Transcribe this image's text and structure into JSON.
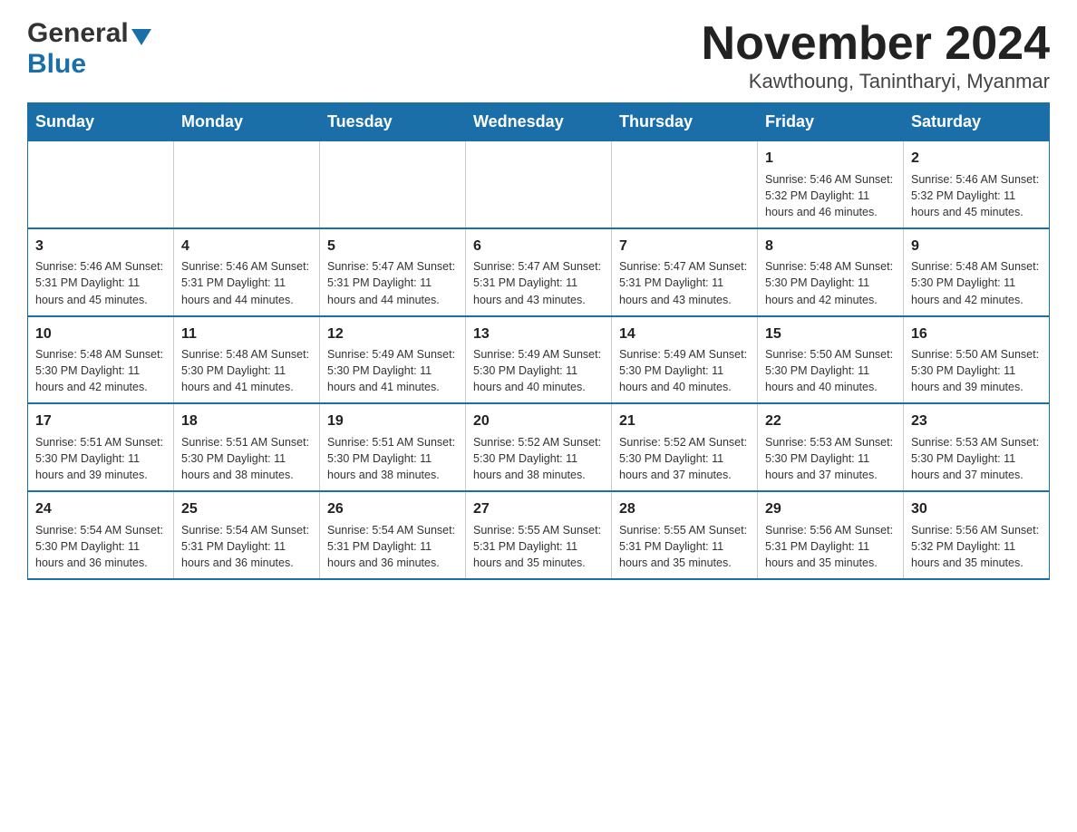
{
  "logo": {
    "general": "General",
    "blue": "Blue"
  },
  "title": "November 2024",
  "subtitle": "Kawthoung, Tanintharyi, Myanmar",
  "days": [
    "Sunday",
    "Monday",
    "Tuesday",
    "Wednesday",
    "Thursday",
    "Friday",
    "Saturday"
  ],
  "weeks": [
    [
      {
        "day": "",
        "info": ""
      },
      {
        "day": "",
        "info": ""
      },
      {
        "day": "",
        "info": ""
      },
      {
        "day": "",
        "info": ""
      },
      {
        "day": "",
        "info": ""
      },
      {
        "day": "1",
        "info": "Sunrise: 5:46 AM\nSunset: 5:32 PM\nDaylight: 11 hours and 46 minutes."
      },
      {
        "day": "2",
        "info": "Sunrise: 5:46 AM\nSunset: 5:32 PM\nDaylight: 11 hours and 45 minutes."
      }
    ],
    [
      {
        "day": "3",
        "info": "Sunrise: 5:46 AM\nSunset: 5:31 PM\nDaylight: 11 hours and 45 minutes."
      },
      {
        "day": "4",
        "info": "Sunrise: 5:46 AM\nSunset: 5:31 PM\nDaylight: 11 hours and 44 minutes."
      },
      {
        "day": "5",
        "info": "Sunrise: 5:47 AM\nSunset: 5:31 PM\nDaylight: 11 hours and 44 minutes."
      },
      {
        "day": "6",
        "info": "Sunrise: 5:47 AM\nSunset: 5:31 PM\nDaylight: 11 hours and 43 minutes."
      },
      {
        "day": "7",
        "info": "Sunrise: 5:47 AM\nSunset: 5:31 PM\nDaylight: 11 hours and 43 minutes."
      },
      {
        "day": "8",
        "info": "Sunrise: 5:48 AM\nSunset: 5:30 PM\nDaylight: 11 hours and 42 minutes."
      },
      {
        "day": "9",
        "info": "Sunrise: 5:48 AM\nSunset: 5:30 PM\nDaylight: 11 hours and 42 minutes."
      }
    ],
    [
      {
        "day": "10",
        "info": "Sunrise: 5:48 AM\nSunset: 5:30 PM\nDaylight: 11 hours and 42 minutes."
      },
      {
        "day": "11",
        "info": "Sunrise: 5:48 AM\nSunset: 5:30 PM\nDaylight: 11 hours and 41 minutes."
      },
      {
        "day": "12",
        "info": "Sunrise: 5:49 AM\nSunset: 5:30 PM\nDaylight: 11 hours and 41 minutes."
      },
      {
        "day": "13",
        "info": "Sunrise: 5:49 AM\nSunset: 5:30 PM\nDaylight: 11 hours and 40 minutes."
      },
      {
        "day": "14",
        "info": "Sunrise: 5:49 AM\nSunset: 5:30 PM\nDaylight: 11 hours and 40 minutes."
      },
      {
        "day": "15",
        "info": "Sunrise: 5:50 AM\nSunset: 5:30 PM\nDaylight: 11 hours and 40 minutes."
      },
      {
        "day": "16",
        "info": "Sunrise: 5:50 AM\nSunset: 5:30 PM\nDaylight: 11 hours and 39 minutes."
      }
    ],
    [
      {
        "day": "17",
        "info": "Sunrise: 5:51 AM\nSunset: 5:30 PM\nDaylight: 11 hours and 39 minutes."
      },
      {
        "day": "18",
        "info": "Sunrise: 5:51 AM\nSunset: 5:30 PM\nDaylight: 11 hours and 38 minutes."
      },
      {
        "day": "19",
        "info": "Sunrise: 5:51 AM\nSunset: 5:30 PM\nDaylight: 11 hours and 38 minutes."
      },
      {
        "day": "20",
        "info": "Sunrise: 5:52 AM\nSunset: 5:30 PM\nDaylight: 11 hours and 38 minutes."
      },
      {
        "day": "21",
        "info": "Sunrise: 5:52 AM\nSunset: 5:30 PM\nDaylight: 11 hours and 37 minutes."
      },
      {
        "day": "22",
        "info": "Sunrise: 5:53 AM\nSunset: 5:30 PM\nDaylight: 11 hours and 37 minutes."
      },
      {
        "day": "23",
        "info": "Sunrise: 5:53 AM\nSunset: 5:30 PM\nDaylight: 11 hours and 37 minutes."
      }
    ],
    [
      {
        "day": "24",
        "info": "Sunrise: 5:54 AM\nSunset: 5:30 PM\nDaylight: 11 hours and 36 minutes."
      },
      {
        "day": "25",
        "info": "Sunrise: 5:54 AM\nSunset: 5:31 PM\nDaylight: 11 hours and 36 minutes."
      },
      {
        "day": "26",
        "info": "Sunrise: 5:54 AM\nSunset: 5:31 PM\nDaylight: 11 hours and 36 minutes."
      },
      {
        "day": "27",
        "info": "Sunrise: 5:55 AM\nSunset: 5:31 PM\nDaylight: 11 hours and 35 minutes."
      },
      {
        "day": "28",
        "info": "Sunrise: 5:55 AM\nSunset: 5:31 PM\nDaylight: 11 hours and 35 minutes."
      },
      {
        "day": "29",
        "info": "Sunrise: 5:56 AM\nSunset: 5:31 PM\nDaylight: 11 hours and 35 minutes."
      },
      {
        "day": "30",
        "info": "Sunrise: 5:56 AM\nSunset: 5:32 PM\nDaylight: 11 hours and 35 minutes."
      }
    ]
  ]
}
